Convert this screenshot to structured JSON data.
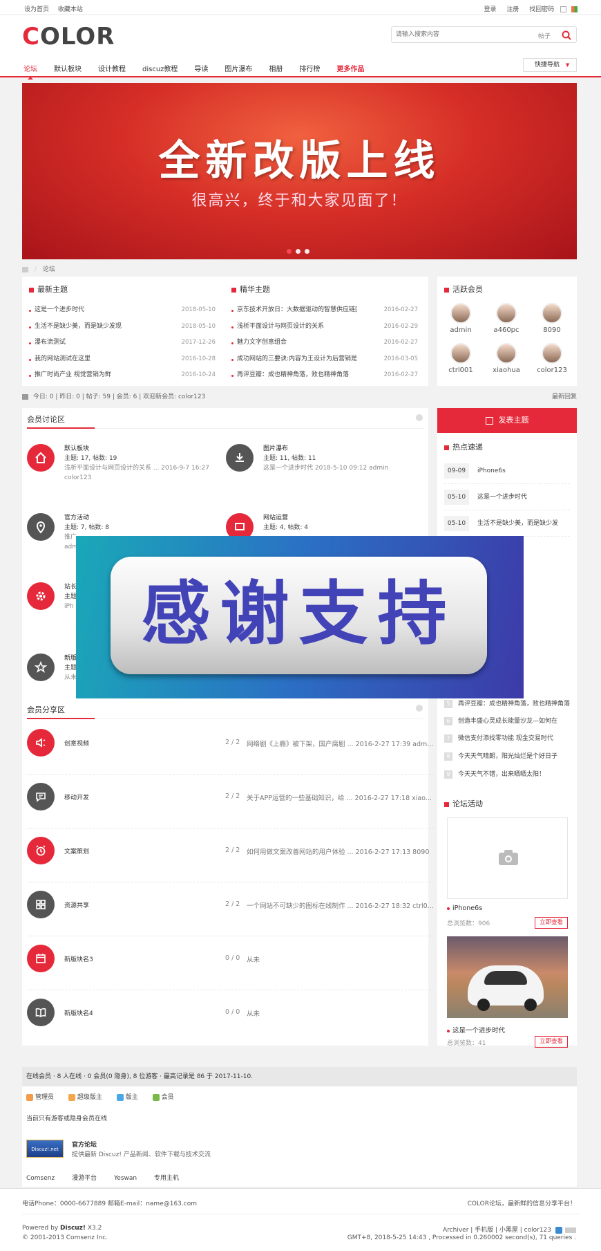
{
  "topbar": {
    "left": [
      "设为首页",
      "收藏本站"
    ],
    "right": [
      "登录",
      "注册",
      "找回密码"
    ]
  },
  "header": {
    "logo": {
      "accent": "C",
      "rest": "OLOR"
    },
    "search": {
      "placeholder": "请输入搜索内容",
      "type": "帖子"
    },
    "nav": [
      "论坛",
      "默认板块",
      "设计教程",
      "discuz教程",
      "导读",
      "图片瀑布",
      "相册",
      "排行榜",
      "更多作品"
    ],
    "quick_nav": "快捷导航"
  },
  "banner": {
    "title": "全新改版上线",
    "subtitle": "很高兴，终于和大家见面了！"
  },
  "breadcrumb": "论坛",
  "latest": {
    "title": "最新主题",
    "items": [
      {
        "t": "这是一个进步时代",
        "d": "2018-05-10"
      },
      {
        "t": "生活不是缺少美，而是缺少发现",
        "d": "2018-05-10"
      },
      {
        "t": "瀑布流测试",
        "d": "2017-12-26"
      },
      {
        "t": "我的网站测试在这里",
        "d": "2016-10-28"
      },
      {
        "t": "推广时尚产业 视觉营销为鲜",
        "d": "2016-10-24"
      }
    ]
  },
  "featured": {
    "title": "精华主题",
    "items": [
      {
        "t": "京东技术开放日：大数据驱动的智慧供应链[",
        "d": "2016-02-27"
      },
      {
        "t": "浅析平面设计与网页设计的关系",
        "d": "2016-02-29"
      },
      {
        "t": "魅力文字创意组合",
        "d": "2016-02-27"
      },
      {
        "t": "成功网站的三要诀:内容为王设计为后营销是",
        "d": "2016-03-05"
      },
      {
        "t": "再评豆瓣：成也精神角落，败也精神角落",
        "d": "2016-02-27"
      }
    ]
  },
  "active_members": {
    "title": "活跃会员",
    "members": [
      "admin",
      "a460pc",
      "8090",
      "ctrl001",
      "xiaohua",
      "color123"
    ]
  },
  "stats": {
    "text": "今日: 0 | 昨日: 0 | 帖子: 59 | 会员: 6 | 欢迎新会员: color123",
    "right": "最新回复"
  },
  "members_area": {
    "title": "会员讨论区",
    "forums": [
      {
        "name": "默认板块",
        "stats": "主题: 17, 帖数: 19",
        "last": "浅析平面设计与网页设计的关系 ... 2016-9-7 16:27",
        "user": "color123"
      },
      {
        "name": "图片瀑布",
        "stats": "主题: 11, 帖数: 11",
        "last": "这是一个进步时代 2018-5-10 09:12 admin",
        "user": ""
      },
      {
        "name": "官方活动",
        "stats": "主题: 7, 帖数: 8",
        "last": "推广",
        "user": "adm"
      },
      {
        "name": "网站运营",
        "stats": "主题: 4, 帖数: 4",
        "last": "",
        "user": ""
      },
      {
        "name": "站长",
        "stats": "主题",
        "last": "iPh",
        "user": ""
      },
      {
        "name": "新版",
        "stats": "主题",
        "last": "从未",
        "user": ""
      }
    ]
  },
  "overlay": {
    "text": "感谢支持"
  },
  "share_area": {
    "title": "会员分享区",
    "items": [
      {
        "name": "创意视频",
        "count": "2 / 2",
        "last": "网络剧《上瘾》被下架，国产腐剧 ... 2016-2-27 17:39 adm..."
      },
      {
        "name": "移动开发",
        "count": "2 / 2",
        "last": "关于APP运营的一些基础知识，给 ... 2016-2-27 17:18 xiao..."
      },
      {
        "name": "文案策划",
        "count": "2 / 2",
        "last": "如何用做文案改善网站的用户体验 ... 2016-2-27 17:13 8090"
      },
      {
        "name": "资源共享",
        "count": "2 / 2",
        "last": "一个网站不可缺少的图标在线制作 ... 2016-2-27 18:32 ctrl0..."
      },
      {
        "name": "新版块名3",
        "count": "0 / 0",
        "last": "从未"
      },
      {
        "name": "新版块名4",
        "count": "0 / 0",
        "last": "从未"
      }
    ]
  },
  "sidebar": {
    "post_button": "发表主题",
    "hot_title": "热点速递",
    "hot": [
      {
        "d": "09-09",
        "t": "iPhone6s"
      },
      {
        "d": "05-10",
        "t": "这是一个进步时代"
      },
      {
        "d": "05-10",
        "t": "生活不是缺少美，而是缺少发"
      }
    ],
    "rank": [
      {
        "n": "5",
        "t": "再评豆瓣：成也精神角落，败也精神角落"
      },
      {
        "n": "6",
        "t": "创造丰盛心灵成长能量沙龙—如何在"
      },
      {
        "n": "7",
        "t": "微信支付添找零功能 现金交易时代"
      },
      {
        "n": "8",
        "t": "今天天气晴朗，阳光灿烂是个好日子"
      },
      {
        "n": "9",
        "t": "今天天气不错，出来晒晒太阳！"
      }
    ],
    "activity_title": "论坛活动",
    "activities": [
      {
        "title": "iPhone6s",
        "count": "总浏览数：906",
        "btn": "立即查看"
      },
      {
        "title": "这是一个进步时代",
        "count": "总浏览数：41",
        "btn": "立即查看"
      }
    ]
  },
  "online": {
    "header": "在线会员 · 8 人在线 · 0 会员(0 隐身), 8 位游客 · 最高记录是 86 于 2017-11-10.",
    "legend": [
      "管理员",
      "超级版主",
      "版主",
      "会员"
    ],
    "legend_colors": [
      "#f39c4a",
      "#f3a74a",
      "#4aa8e8",
      "#7ab84a"
    ],
    "note": "当前只有游客或隐身会员在线"
  },
  "links": {
    "badge": "Discuz!.net",
    "title": "官方论坛",
    "desc": "提供最新 Discuz! 产品新闻、软件下载与技术交流",
    "items": [
      "Comsenz",
      "漫游平台",
      "Yeswan",
      "专用主机"
    ]
  },
  "footer": {
    "contact": "电话Phone：0000-6677889    邮箱E-mail：name@163.com",
    "slogan": "COLOR论坛，最新鲜的信息分享平台！",
    "powered_label": "Powered by ",
    "powered_name": "Discuz!",
    "powered_ver": " X3.2",
    "copyright": "© 2001-2013 Comsenz Inc.",
    "links": "Archiver | 手机版 | 小黑屋 | color123",
    "gmt": "GMT+8, 2018-5-25 14:43 , Processed in 0.260002 second(s), 71 queries ."
  },
  "colors": {
    "accent": "#e5293a",
    "dark": "#555555"
  }
}
